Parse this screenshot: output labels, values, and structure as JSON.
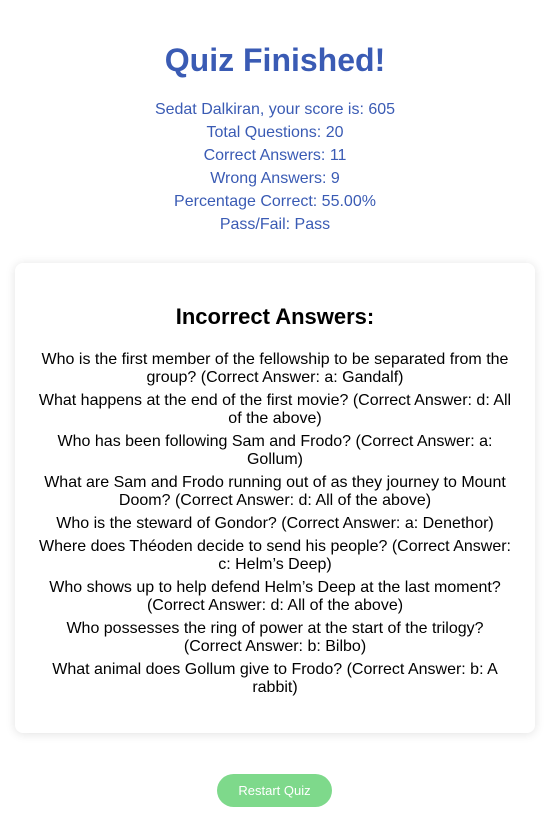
{
  "title": "Quiz Finished!",
  "stats": {
    "score_line": "Sedat Dalkiran, your score is: 605",
    "total_questions": "Total Questions: 20",
    "correct_answers": "Correct Answers: 11",
    "wrong_answers": "Wrong Answers: 9",
    "percentage": "Percentage Correct: 55.00%",
    "pass_fail": "Pass/Fail: Pass"
  },
  "incorrect": {
    "heading": "Incorrect Answers:",
    "items": [
      "Who is the first member of the fellowship to be separated from the group? (Correct Answer: a: Gandalf)",
      "What happens at the end of the first movie? (Correct Answer: d: All of the above)",
      "Who has been following Sam and Frodo? (Correct Answer: a: Gollum)",
      "What are Sam and Frodo running out of as they journey to Mount Doom? (Correct Answer: d: All of the above)",
      "Who is the steward of Gondor? (Correct Answer: a: Denethor)",
      "Where does Théoden decide to send his people? (Correct Answer: c: Helm’s Deep)",
      "Who shows up to help defend Helm’s Deep at the last moment? (Correct Answer: d: All of the above)",
      "Who possesses the ring of power at the start of the trilogy? (Correct Answer: b: Bilbo)",
      "What animal does Gollum give to Frodo? (Correct Answer: b: A rabbit)"
    ]
  },
  "restart_label": "Restart Quiz",
  "colors": {
    "accent": "#3a5bb4",
    "button": "#7ed98b"
  }
}
